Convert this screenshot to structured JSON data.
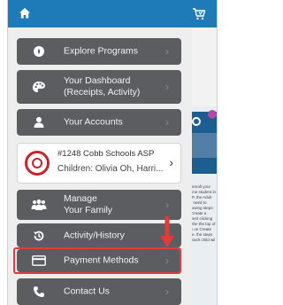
{
  "menu": {
    "explore": "Explore Programs",
    "dashboard": "Your Dashboard\n(Receipts, Activity)",
    "accounts": "Your Accounts",
    "manage": "Manage\nYour Family",
    "activity": "Activity/History",
    "payment": "Payment Methods",
    "contact": "Contact Us"
  },
  "school": {
    "title": "#1248 Cobb Schools ASP",
    "children": "Children: Olivia Oh, Harri..."
  },
  "side_panel": {
    "text": "To enroll your eleme student in ASP, the Adult will need to following steps: 1. Create a Parent clicking on the the top of this on Create One. the steps 2. Each child wil"
  },
  "colors": {
    "topbar": "#1f7ab8",
    "menu_item": "#5b5d61",
    "highlight": "#e23b3b"
  }
}
